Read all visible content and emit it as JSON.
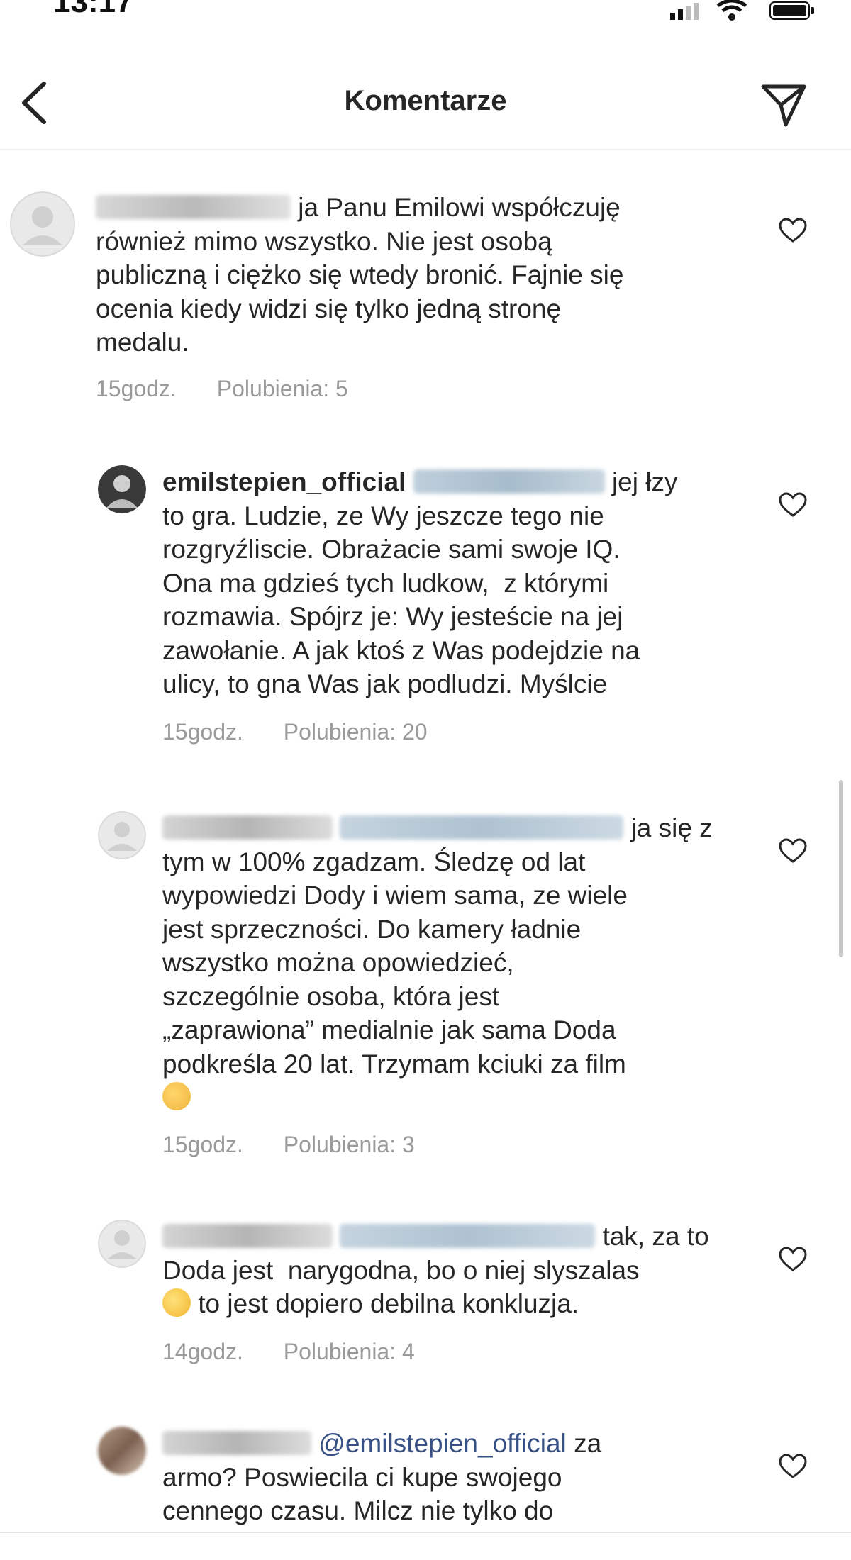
{
  "status": {
    "time": "13:17"
  },
  "header": {
    "title": "Komentarze"
  },
  "comments": [
    {
      "mention": "",
      "lines": [
        "ja Panu Emilowi współczuję",
        "również mimo wszystko. Nie jest osobą",
        "publiczną i ciężko się wtedy bronić. Fajnie się",
        "ocenia kiedy widzi się tylko jedną stronę",
        "medalu."
      ],
      "time": "15godz.",
      "likes": "Polubienia: 5"
    },
    {
      "username": "emilstepien_official",
      "mention": "",
      "lines": [
        "jej łzy",
        "to gra. Ludzie, ze Wy jeszcze tego nie",
        "rozgryźliscie. Obrażacie sami swoje IQ.",
        "Ona ma gdzieś tych ludkow,  z którymi",
        "rozmawia. Spójrz je: Wy jesteście na jej",
        "zawołanie. A jak ktoś z Was podejdzie na",
        "ulicy, to gna Was jak podludzi. Myślcie"
      ],
      "time": "15godz.",
      "likes": "Polubienia: 20"
    },
    {
      "mention": "",
      "lines": [
        "ja się z",
        "tym w 100% zgadzam. Śledzę od lat",
        "wypowiedzi Dody i wiem sama, ze wiele",
        "jest sprzeczności. Do kamery ładnie",
        "wszystko można opowiedzieć,",
        "szczególnie osoba, która jest",
        "„zaprawiona” medialnie jak sama Doda",
        "podkreśla 20 lat. Trzymam kciuki za film"
      ],
      "emoji": "clapping-hands",
      "time": "15godz.",
      "likes": "Polubienia: 3"
    },
    {
      "mention": "",
      "lines": [
        "tak, za to",
        "Doda jest  narygodna, bo o niej slyszalas",
        "to jest dopiero debilna konkluzja."
      ],
      "emoji": "laughing-face",
      "time": "14godz.",
      "likes": "Polubienia: 4"
    },
    {
      "mention": "@emilstepien_official",
      "lines": [
        "za",
        "armo? Poswiecila ci kupe swojego",
        "cennego czasu. Milcz nie tylko do"
      ]
    }
  ],
  "colors": {
    "mention": "#385185",
    "meta": "#9a9a9a",
    "text": "#262626"
  },
  "icons": [
    "back-chevron-icon",
    "send-icon",
    "heart-icon",
    "signal-icon",
    "wifi-icon",
    "battery-icon"
  ]
}
